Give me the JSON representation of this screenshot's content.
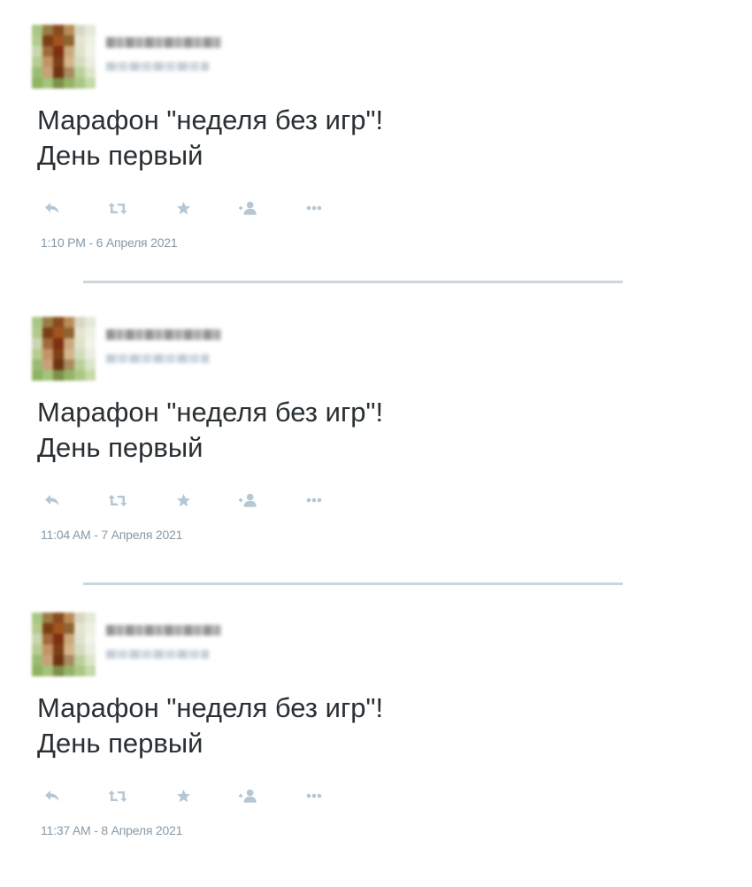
{
  "tweets": [
    {
      "text": "Марафон \"неделя без игр\"!\nДень первый",
      "timestamp": "1:10 PM - 6 Апреля 2021"
    },
    {
      "text": "Марафон \"неделя без игр\"!\nДень первый",
      "timestamp": "11:04 AM - 7 Апреля 2021"
    },
    {
      "text": "Марафон \"неделя без игр\"!\nДень первый",
      "timestamp": "11:37 AM - 8 Апреля 2021"
    }
  ],
  "icons": {
    "reply": "reply-icon",
    "retweet": "retweet-icon",
    "favorite": "star-icon",
    "follow": "follow-icon",
    "more": "more-icon"
  },
  "colors": {
    "text": "#292f33",
    "icon": "#b5c6d4",
    "timestamp": "#8899a6",
    "divider": "#ccd6dd"
  }
}
